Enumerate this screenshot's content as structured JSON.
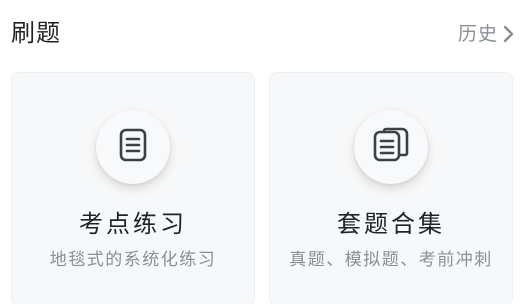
{
  "header": {
    "title": "刷题",
    "history_label": "历史"
  },
  "cards": [
    {
      "title": "考点练习",
      "subtitle": "地毯式的系统化练习",
      "icon": "document-list-icon"
    },
    {
      "title": "套题合集",
      "subtitle": "真题、模拟题、考前冲刺",
      "icon": "stacked-documents-icon"
    }
  ],
  "colors": {
    "text_primary": "#1f2326",
    "text_secondary": "#8a8f94",
    "card_background": "#f7f8f9"
  }
}
